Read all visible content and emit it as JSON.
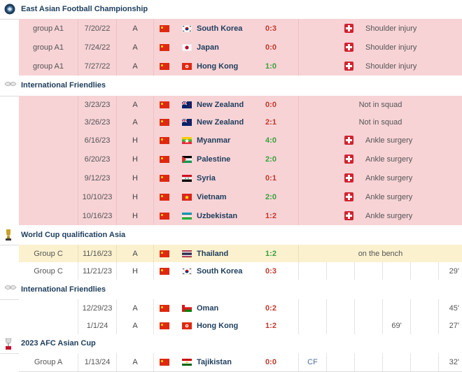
{
  "sections": [
    {
      "competition": "East Asian Football Championship",
      "icon": "eaff-logo-icon",
      "rows": [
        {
          "type": "injury",
          "group": "group A1",
          "date": "7/20/22",
          "venue": "A",
          "opponent": "South Korea",
          "opp_flag": "kr",
          "result": "0:3",
          "result_class": "loss",
          "status": "Shoulder injury"
        },
        {
          "type": "injury",
          "group": "group A1",
          "date": "7/24/22",
          "venue": "A",
          "opponent": "Japan",
          "opp_flag": "jp",
          "result": "0:0",
          "result_class": "draw",
          "status": "Shoulder injury"
        },
        {
          "type": "injury",
          "group": "group A1",
          "date": "7/27/22",
          "venue": "A",
          "opponent": "Hong Kong",
          "opp_flag": "hk",
          "result": "1:0",
          "result_class": "win",
          "status": "Shoulder injury"
        }
      ]
    },
    {
      "competition": "International Friendlies",
      "icon": "friendlies-logo-icon",
      "rows": [
        {
          "type": "squad",
          "group": "",
          "date": "3/23/23",
          "venue": "A",
          "opponent": "New Zealand",
          "opp_flag": "nz",
          "result": "0:0",
          "result_class": "draw",
          "status": "Not in squad"
        },
        {
          "type": "squad",
          "group": "",
          "date": "3/26/23",
          "venue": "A",
          "opponent": "New Zealand",
          "opp_flag": "nz",
          "result": "2:1",
          "result_class": "loss",
          "status": "Not in squad"
        },
        {
          "type": "injury",
          "group": "",
          "date": "6/16/23",
          "venue": "H",
          "opponent": "Myanmar",
          "opp_flag": "mm",
          "result": "4:0",
          "result_class": "win",
          "status": "Ankle surgery"
        },
        {
          "type": "injury",
          "group": "",
          "date": "6/20/23",
          "venue": "H",
          "opponent": "Palestine",
          "opp_flag": "ps",
          "result": "2:0",
          "result_class": "win",
          "status": "Ankle surgery"
        },
        {
          "type": "injury",
          "group": "",
          "date": "9/12/23",
          "venue": "H",
          "opponent": "Syria",
          "opp_flag": "sy",
          "result": "0:1",
          "result_class": "loss",
          "status": "Ankle surgery"
        },
        {
          "type": "injury",
          "group": "",
          "date": "10/10/23",
          "venue": "H",
          "opponent": "Vietnam",
          "opp_flag": "vn",
          "result": "2:0",
          "result_class": "win",
          "status": "Ankle surgery"
        },
        {
          "type": "injury",
          "group": "",
          "date": "10/16/23",
          "venue": "H",
          "opponent": "Uzbekistan",
          "opp_flag": "uz",
          "result": "1:2",
          "result_class": "loss",
          "status": "Ankle surgery"
        }
      ]
    },
    {
      "competition": "World Cup qualification Asia",
      "icon": "world-cup-trophy-icon",
      "rows": [
        {
          "type": "bench",
          "group": "Group C",
          "date": "11/16/23",
          "venue": "A",
          "opponent": "Thailand",
          "opp_flag": "th",
          "result": "1:2",
          "result_class": "win",
          "status": "on the bench"
        },
        {
          "type": "played",
          "group": "Group C",
          "date": "11/21/23",
          "venue": "H",
          "opponent": "South Korea",
          "opp_flag": "kr",
          "result": "0:3",
          "result_class": "loss",
          "position": "",
          "stat3": "",
          "minutes": "29'"
        }
      ]
    },
    {
      "competition": "International Friendlies",
      "icon": "friendlies-logo-icon",
      "rows": [
        {
          "type": "played",
          "group": "",
          "date": "12/29/23",
          "venue": "A",
          "opponent": "Oman",
          "opp_flag": "om",
          "result": "0:2",
          "result_class": "loss",
          "position": "",
          "stat3": "",
          "minutes": "45'"
        },
        {
          "type": "played",
          "group": "",
          "date": "1/1/24",
          "venue": "A",
          "opponent": "Hong Kong",
          "opp_flag": "hk",
          "result": "1:2",
          "result_class": "loss",
          "position": "",
          "stat3": "69'",
          "minutes": "27'"
        }
      ]
    },
    {
      "competition": "2023 AFC Asian Cup",
      "icon": "afc-asian-cup-icon",
      "rows": [
        {
          "type": "played",
          "group": "Group A",
          "date": "1/13/24",
          "venue": "A",
          "opponent": "Tajikistan",
          "opp_flag": "tj",
          "result": "0:0",
          "result_class": "draw",
          "position": "CF",
          "stat3": "",
          "minutes": "32'"
        }
      ]
    }
  ],
  "colors": {
    "injury_row": "#f7d3d6",
    "bench_row": "#fbf1cf",
    "competition_text": "#1d3d5c",
    "loss": "#c0392b",
    "win": "#38a03c",
    "injury_icon": "#d0222f"
  }
}
